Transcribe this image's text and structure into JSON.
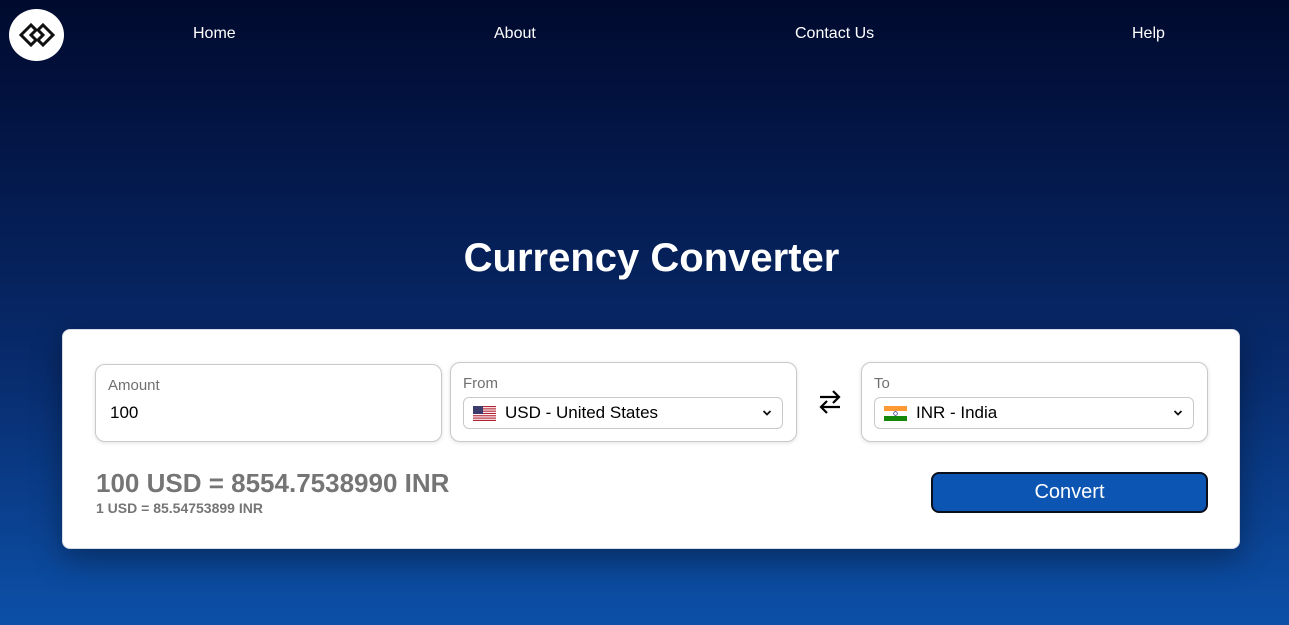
{
  "nav": {
    "items": [
      {
        "label": "Home"
      },
      {
        "label": "About"
      },
      {
        "label": "Contact Us"
      },
      {
        "label": "Help"
      }
    ]
  },
  "main": {
    "title": "Currency Converter"
  },
  "form": {
    "amount_label": "Amount",
    "amount_value": "100",
    "from_label": "From",
    "from_selected": "USD - United States",
    "from_flag": "us-flag-icon",
    "to_label": "To",
    "to_selected": "INR - India",
    "to_flag": "india-flag-icon",
    "swap_icon": "swap-arrows-icon"
  },
  "result": {
    "main": "100 USD = 8554.7538990 INR",
    "rate": "1 USD = 85.54753899 INR"
  },
  "actions": {
    "convert_label": "Convert"
  },
  "colors": {
    "accent": "#0d55b3",
    "result_text": "#757575"
  }
}
